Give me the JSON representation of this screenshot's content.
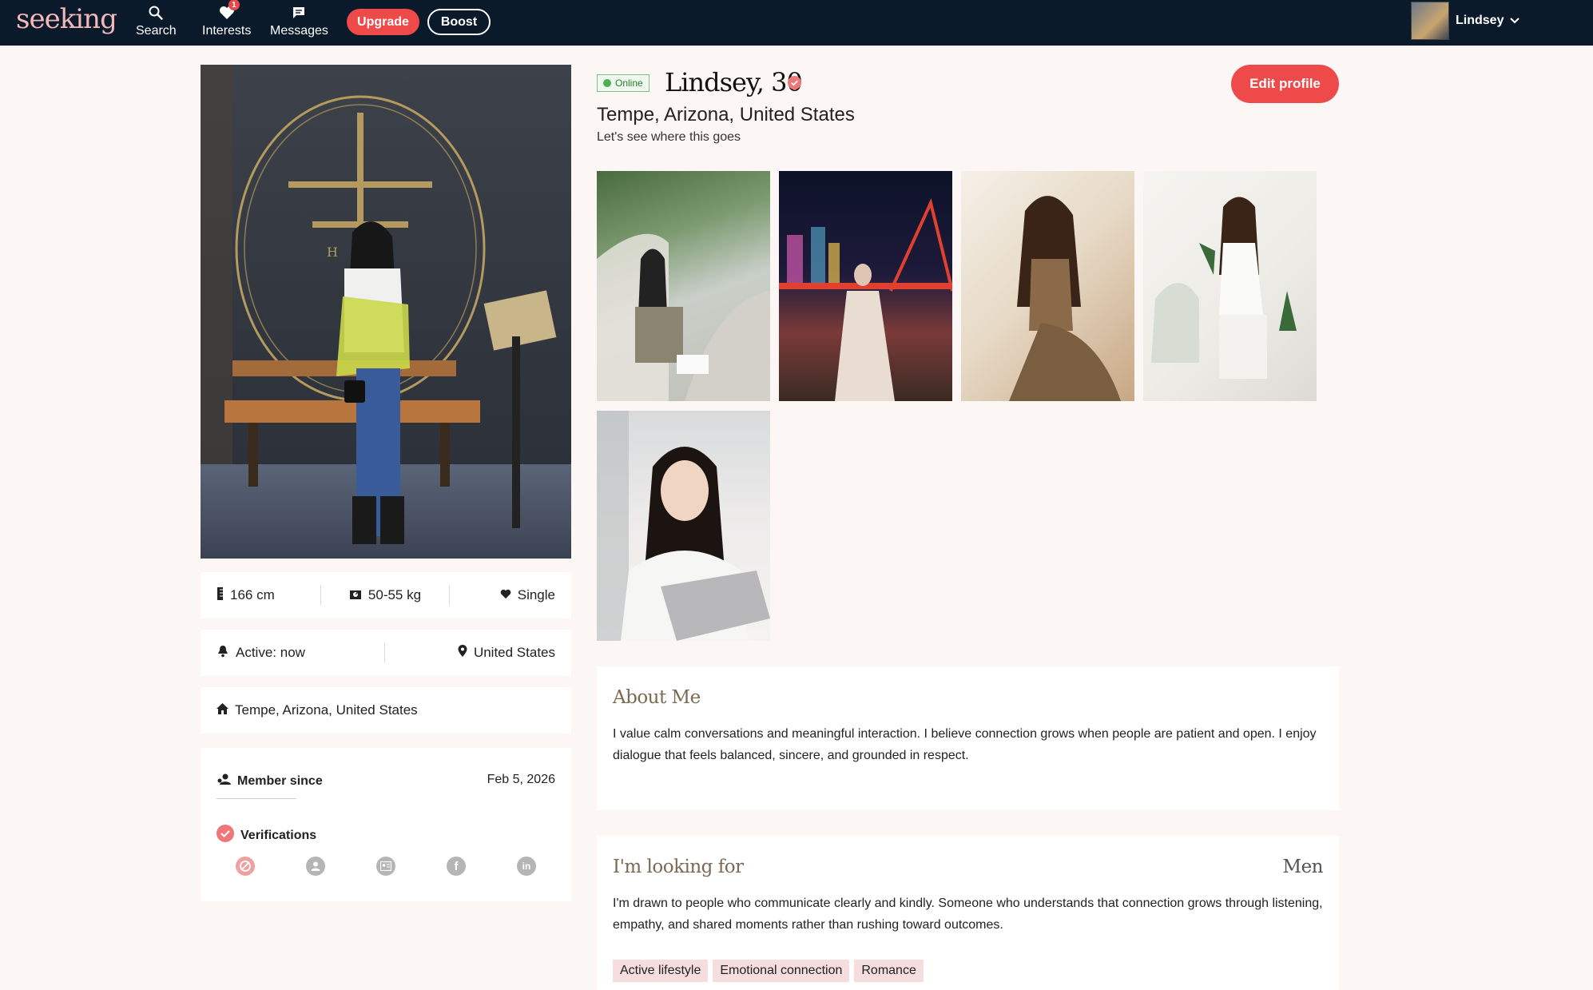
{
  "nav": {
    "logo": "seeking",
    "items": [
      {
        "label": "Search",
        "icon": "search-icon"
      },
      {
        "label": "Interests",
        "icon": "heart-icon",
        "badge": "1"
      },
      {
        "label": "Messages",
        "icon": "message-icon"
      }
    ],
    "upgrade_label": "Upgrade",
    "boost_label": "Boost",
    "user_name": "Lindsey"
  },
  "profile": {
    "online_label": "Online",
    "name_age": "Lindsey, 30",
    "location": "Tempe, Arizona, United States",
    "tagline": "Let's see where this goes",
    "edit_label": "Edit profile"
  },
  "stats": {
    "height": "166 cm",
    "weight": "50-55 kg",
    "relationship": "Single",
    "active": "Active: now",
    "country": "United States",
    "home": "Tempe, Arizona, United States"
  },
  "membership": {
    "member_since_label": "Member since",
    "member_since_value": "Feb 5, 2026",
    "verifications_label": "Verifications",
    "verification_icons": [
      "photo-verify-icon",
      "profile-verify-icon",
      "id-verify-icon",
      "facebook-icon",
      "linkedin-icon"
    ]
  },
  "about": {
    "title": "About Me",
    "body": "I value calm conversations and meaningful interaction. I believe connection grows when people are patient and open. I enjoy dialogue that feels balanced, sincere, and grounded in respect."
  },
  "looking_for": {
    "title": "I'm looking for",
    "target": "Men",
    "body": "I'm drawn to people who communicate clearly and kindly. Someone who understands that connection grows through listening, empathy, and shared moments rather than rushing toward outcomes.",
    "tags": [
      "Active lifestyle",
      "Emotional connection",
      "Romance"
    ]
  },
  "colors": {
    "nav_bg": "#0b1a2b",
    "accent": "#ef4a4a",
    "page_bg": "#fcf6f4",
    "online": "#4caf50"
  }
}
